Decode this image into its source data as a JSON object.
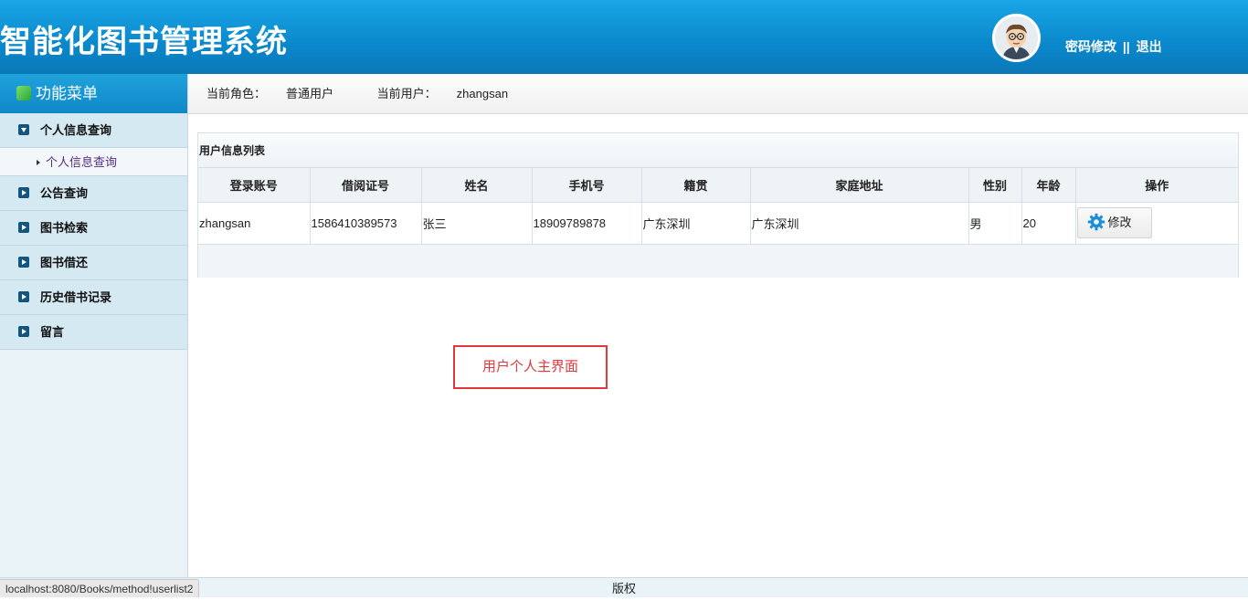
{
  "header": {
    "title": "智能化图书管理系统",
    "change_password": "密码修改",
    "separator": "||",
    "logout": "退出"
  },
  "sidebar": {
    "title": "功能菜单",
    "items": [
      {
        "label": "个人信息查询",
        "expanded": true,
        "children": [
          {
            "label": "个人信息查询"
          }
        ]
      },
      {
        "label": "公告查询"
      },
      {
        "label": "图书检索"
      },
      {
        "label": "图书借还"
      },
      {
        "label": "历史借书记录"
      },
      {
        "label": "留言"
      }
    ]
  },
  "infobar": {
    "role_label": "当前角色：",
    "role": "普通用户",
    "user_label": "当前用户：",
    "user": "zhangsan"
  },
  "panel": {
    "title": "用户信息列表",
    "columns": [
      "登录账号",
      "借阅证号",
      "姓名",
      "手机号",
      "籍贯",
      "家庭地址",
      "性别",
      "年龄",
      "操作"
    ],
    "rows": [
      [
        "zhangsan",
        "1586410389573",
        "张三",
        "18909789878",
        "广东深圳",
        "广东深圳",
        "男",
        "20"
      ]
    ],
    "edit_label": "修改"
  },
  "annotation": "用户个人主界面",
  "footer": {
    "copyright": "版权"
  },
  "status_url": "localhost:8080/Books/method!userlist2",
  "colors": {
    "header": "#0a88cc",
    "sidebar": "#d4e9f2",
    "annotation": "#e0383b"
  }
}
